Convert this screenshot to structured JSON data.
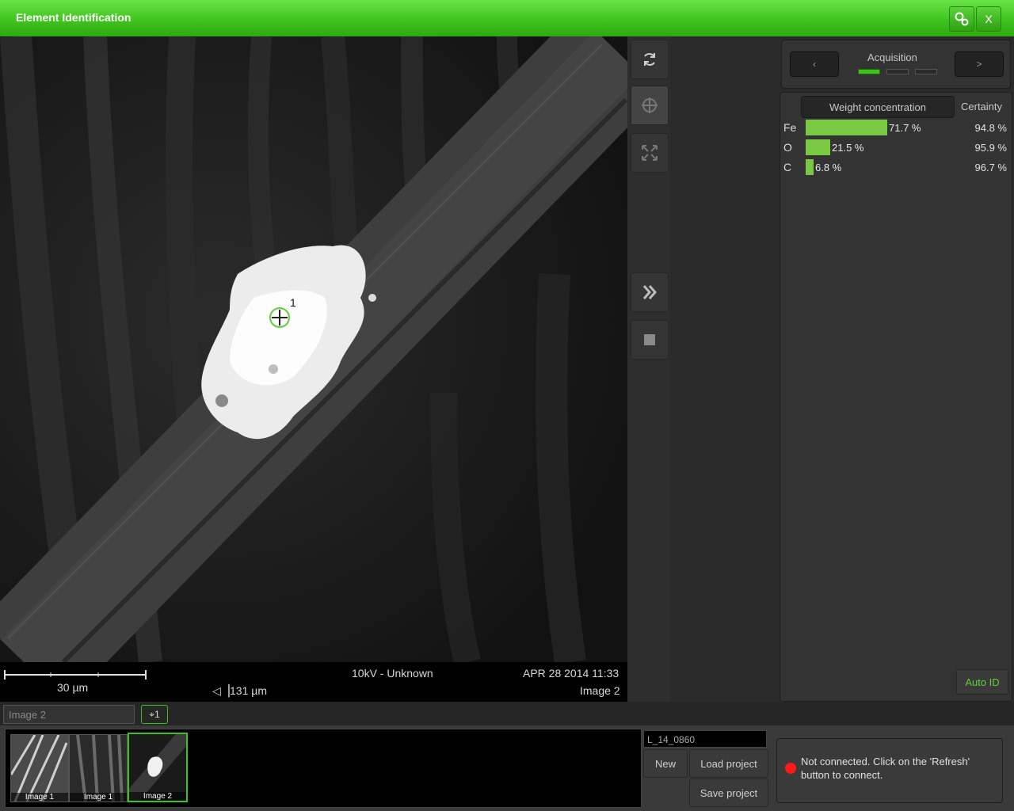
{
  "window": {
    "title": "Element Identification",
    "settings_icon": "gears-icon",
    "close_label": "X",
    "accent": "#3cc21a"
  },
  "image": {
    "marker_label": "1",
    "scale_length": "30 µm",
    "field_width": "131 µm",
    "conditions": "10kV - Unknown",
    "datetime": "APR 28 2014 11:33",
    "image_name": "Image 2"
  },
  "tools": {
    "refresh_icon": "refresh-icon",
    "crosshair_icon": "crosshair-icon",
    "expand_icon": "expand-icon",
    "forward_icon": "double-chevron-icon",
    "stop_icon": "stop-icon"
  },
  "acquisition": {
    "title": "Acquisition",
    "prev_label": "‹",
    "next_label": ">",
    "steps": 3,
    "active_step": 1
  },
  "results": {
    "col_weight": "Weight concentration",
    "col_certainty": "Certainty",
    "bar_color": "#7ac943",
    "rows": [
      {
        "element": "Fe",
        "weight": 71.7,
        "weight_label": "71.7 %",
        "certainty": "94.8 %"
      },
      {
        "element": "O",
        "weight": 21.5,
        "weight_label": "21.5 %",
        "certainty": "95.9 %"
      },
      {
        "element": "C",
        "weight": 6.8,
        "weight_label": "6.8 %",
        "certainty": "96.7 %"
      }
    ],
    "auto_id_label": "Auto ID"
  },
  "bottom": {
    "image_tab": "Image 2",
    "points_badge": "1",
    "thumbnails": [
      {
        "label": "Image 1"
      },
      {
        "label": "Image 1"
      },
      {
        "label": "Image 2",
        "selected": true
      }
    ],
    "project_name": "L_14_0860",
    "new_label": "New",
    "load_label": "Load project",
    "save_label": "Save project",
    "status_text": "Not connected. Click on the 'Refresh' button to connect.",
    "status_color": "#ff1a1a"
  }
}
